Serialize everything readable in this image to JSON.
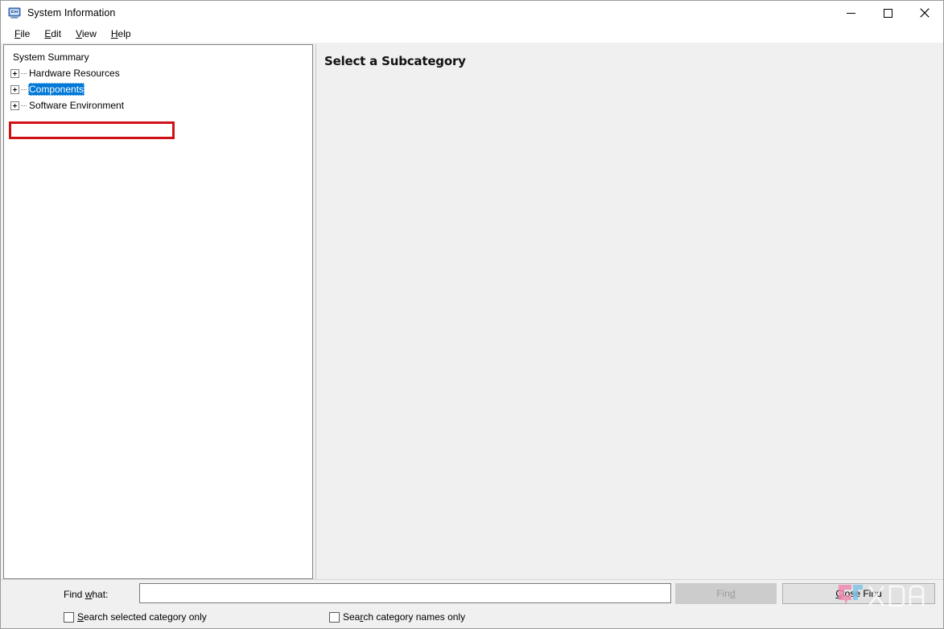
{
  "window": {
    "title": "System Information",
    "icon": "system-information-icon",
    "controls": {
      "minimize": "minimize-icon",
      "maximize": "maximize-icon",
      "close": "close-icon"
    }
  },
  "menubar": {
    "items": [
      {
        "label": "File",
        "accel": "F"
      },
      {
        "label": "Edit",
        "accel": "E"
      },
      {
        "label": "View",
        "accel": "V"
      },
      {
        "label": "Help",
        "accel": "H"
      }
    ]
  },
  "tree": {
    "nodes": [
      {
        "label": "System Summary",
        "expandable": false,
        "selected": false
      },
      {
        "label": "Hardware Resources",
        "expandable": true,
        "selected": false
      },
      {
        "label": "Components",
        "expandable": true,
        "selected": true
      },
      {
        "label": "Software Environment",
        "expandable": true,
        "selected": false
      }
    ]
  },
  "annotation": {
    "target": "Components",
    "color": "#d01217"
  },
  "detail": {
    "heading": "Select a Subcategory"
  },
  "findbar": {
    "find_label_pre": "Find ",
    "find_label_accel": "w",
    "find_label_post": "hat:",
    "input_value": "",
    "input_placeholder": "",
    "find_button": {
      "label_pre": "Fin",
      "accel": "d",
      "label_post": "",
      "enabled": false
    },
    "close_button": {
      "label_pre": "",
      "accel": "C",
      "label_post": "lose Find",
      "enabled": true
    },
    "checkboxes": [
      {
        "pre": "",
        "accel": "S",
        "post": "earch selected category only",
        "checked": false
      },
      {
        "pre": "Sea",
        "accel": "r",
        "post": "ch category names only",
        "checked": false
      }
    ]
  },
  "watermark": {
    "text": "XDA",
    "mark_color_pink": "#f08ab0",
    "mark_color_blue": "#7fc4e8"
  },
  "colors": {
    "selection": "#0078d7",
    "annotation": "#d01217",
    "panel_bg": "#f0f0f0",
    "tree_bg": "#ffffff"
  }
}
